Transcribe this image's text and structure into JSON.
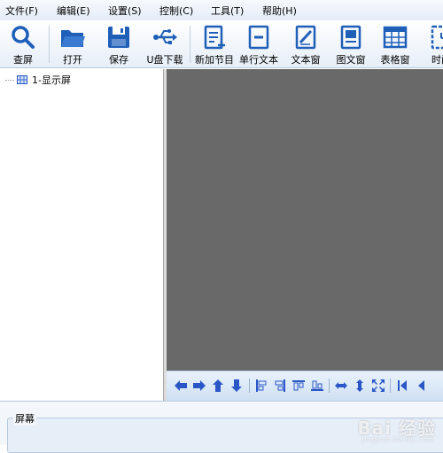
{
  "menu": [
    "文件(F)",
    "编辑(E)",
    "设置(S)",
    "控制(C)",
    "工具(T)",
    "帮助(H)"
  ],
  "toolbar": {
    "query_screen": "查屏",
    "open": "打开",
    "save": "保存",
    "usb_download": "U盘下载",
    "new_program": "新加节目",
    "single_line_text": "单行文本",
    "text_window": "文本窗",
    "image_text_window": "图文窗",
    "table_window": "表格窗",
    "time": "时间"
  },
  "tree": {
    "node_label": "1-显示屏"
  },
  "bottom_panel": {
    "group_label": "屏幕"
  },
  "watermark": {
    "text": "Bai 经验",
    "sub": "jingyan.baidu.com"
  },
  "colors": {
    "icon_blue": "#1f5fb8",
    "canvas_gray": "#696969",
    "arrow_blue": "#2a56c6"
  },
  "align_tools": [
    "move-left-icon",
    "move-right-icon",
    "move-up-icon",
    "move-down-icon",
    "align-left-icon",
    "align-right-icon",
    "align-top-icon",
    "align-bottom-icon",
    "stretch-horizontal-icon",
    "stretch-vertical-icon",
    "fullscreen-icon",
    "first-icon",
    "prev-icon"
  ]
}
